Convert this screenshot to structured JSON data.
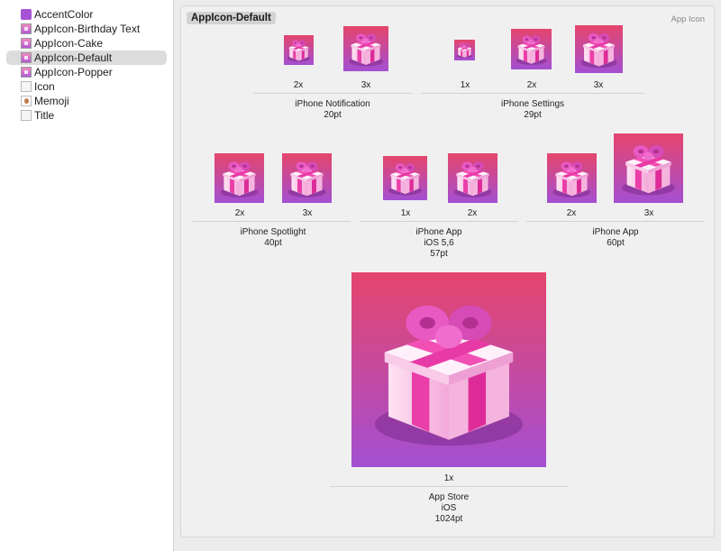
{
  "sidebar": {
    "items": [
      {
        "label": "AccentColor",
        "icon": "color-swatch-icon",
        "selected": false
      },
      {
        "label": "AppIcon-Birthday Text",
        "icon": "app-icon-set-icon",
        "selected": false
      },
      {
        "label": "AppIcon-Cake",
        "icon": "app-icon-set-icon",
        "selected": false
      },
      {
        "label": "AppIcon-Default",
        "icon": "app-icon-set-icon",
        "selected": true
      },
      {
        "label": "AppIcon-Popper",
        "icon": "app-icon-set-icon",
        "selected": false
      },
      {
        "label": "Icon",
        "icon": "image-set-icon",
        "selected": false
      },
      {
        "label": "Memoji",
        "icon": "memoji-image-icon",
        "selected": false
      },
      {
        "label": "Title",
        "icon": "image-set-icon",
        "selected": false
      }
    ]
  },
  "main": {
    "set_title": "AppIcon-Default",
    "set_type": "App Icon",
    "groups": [
      {
        "slots": [
          "2x",
          "3x"
        ],
        "label": [
          "iPhone Notification",
          "20pt"
        ]
      },
      {
        "slots": [
          "1x",
          "2x",
          "3x"
        ],
        "label": [
          "iPhone Settings",
          "29pt"
        ]
      },
      {
        "slots": [
          "2x",
          "3x"
        ],
        "label": [
          "iPhone Spotlight",
          "40pt"
        ]
      },
      {
        "slots": [
          "1x",
          "2x"
        ],
        "label": [
          "iPhone App",
          "iOS 5,6",
          "57pt"
        ]
      },
      {
        "slots": [
          "2x",
          "3x"
        ],
        "label": [
          "iPhone App",
          "60pt"
        ]
      },
      {
        "slots": [
          "1x"
        ],
        "label": [
          "App Store",
          "iOS",
          "1024pt"
        ]
      }
    ]
  },
  "colors": {
    "icon_top": "#e5456c",
    "icon_bottom": "#a44fd2",
    "selection": "#dcdcdc"
  }
}
